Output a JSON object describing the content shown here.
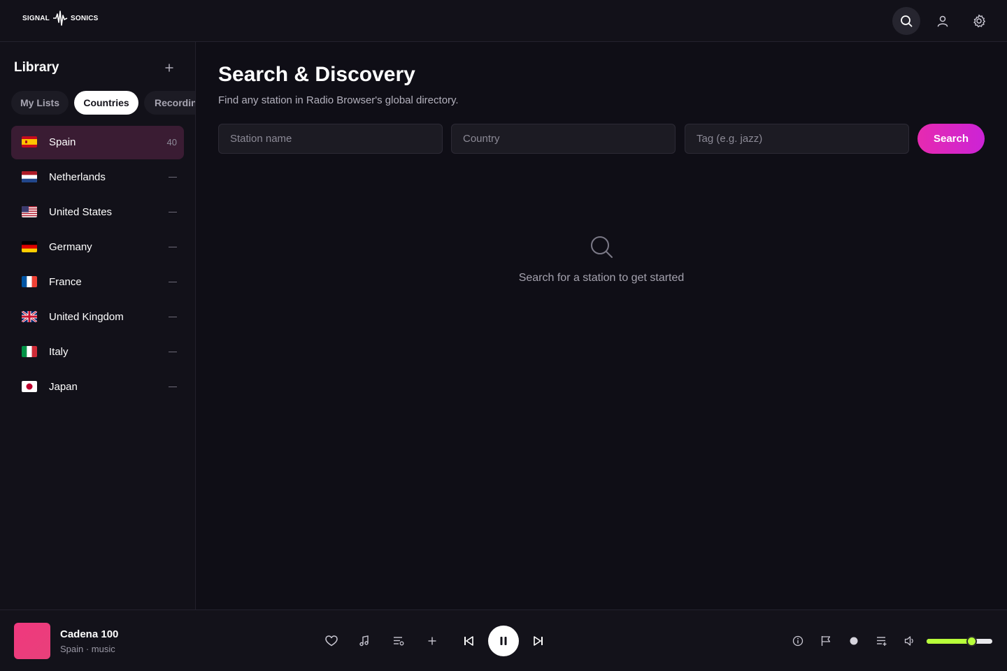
{
  "app": {
    "logo_left": "SIGNAL",
    "logo_right": "SONICS"
  },
  "topbar": {
    "icons": [
      "search-icon",
      "user-icon",
      "gear-icon"
    ]
  },
  "sidebar": {
    "title": "Library",
    "tabs": [
      {
        "label": "My Lists",
        "active": false
      },
      {
        "label": "Countries",
        "active": true
      },
      {
        "label": "Recordings",
        "active": false
      }
    ],
    "countries": [
      {
        "name": "Spain",
        "count": "40",
        "active": true
      },
      {
        "name": "Netherlands",
        "count": null,
        "active": false
      },
      {
        "name": "United States",
        "count": null,
        "active": false
      },
      {
        "name": "Germany",
        "count": null,
        "active": false
      },
      {
        "name": "France",
        "count": null,
        "active": false
      },
      {
        "name": "United Kingdom",
        "count": null,
        "active": false
      },
      {
        "name": "Italy",
        "count": null,
        "active": false
      },
      {
        "name": "Japan",
        "count": null,
        "active": false
      }
    ]
  },
  "main": {
    "title": "Search & Discovery",
    "subtitle": "Find any station in Radio Browser's global directory.",
    "fields": {
      "station_placeholder": "Station name",
      "country_placeholder": "Country",
      "tag_placeholder": "Tag (e.g. jazz)"
    },
    "search_label": "Search",
    "empty_text": "Search for a station to get started"
  },
  "player": {
    "station": "Cadena 100",
    "meta": "Spain · music",
    "volume_percent": 68
  },
  "colors": {
    "accent": "#e62ab0",
    "volume": "#b8ff3a",
    "active_row": "#3a1c33",
    "artwork": "#f0387e"
  }
}
